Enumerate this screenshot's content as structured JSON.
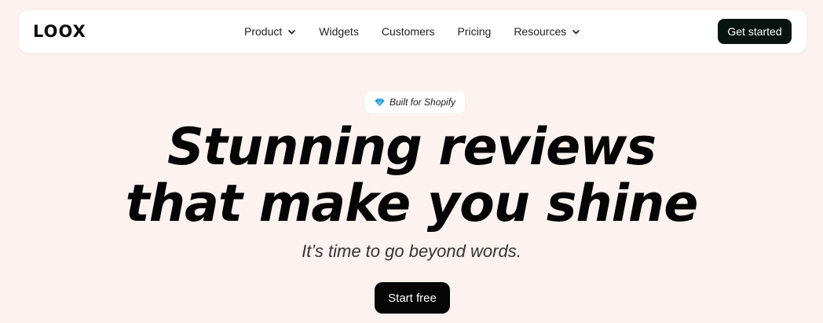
{
  "colors": {
    "page_background": "#fcf3f0",
    "nav_background": "#ffffff",
    "cta_nav_background": "#071410",
    "cta_main_background": "#050505",
    "gem_icon": "#3aa3d6"
  },
  "header": {
    "logo_text": "LOOX",
    "nav": [
      {
        "label": "Product",
        "has_dropdown": true
      },
      {
        "label": "Widgets",
        "has_dropdown": false
      },
      {
        "label": "Customers",
        "has_dropdown": false
      },
      {
        "label": "Pricing",
        "has_dropdown": false
      },
      {
        "label": "Resources",
        "has_dropdown": true
      }
    ],
    "cta_label": "Get started"
  },
  "hero": {
    "badge": {
      "icon": "diamond-icon",
      "text": "Built for Shopify"
    },
    "headline_line1": "Stunning reviews",
    "headline_line2": "that make you shine",
    "subheadline": "It’s time to go beyond words.",
    "cta_label": "Start free"
  }
}
